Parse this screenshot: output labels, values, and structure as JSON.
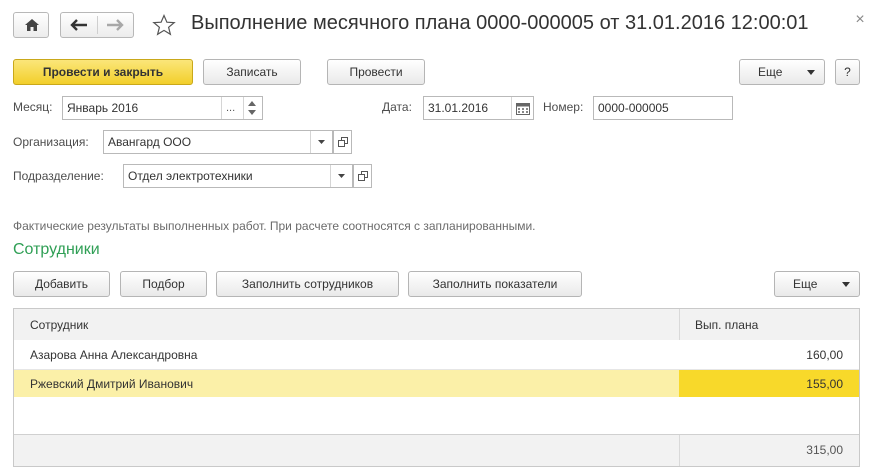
{
  "window": {
    "title": "Выполнение месячного плана 0000-000005 от 31.01.2016 12:00:01",
    "close_glyph": "×"
  },
  "toolbar": {
    "post_close_label": "Провести и закрыть",
    "save_label": "Записать",
    "post_label": "Провести",
    "more_label": "Еще",
    "help_label": "?"
  },
  "form": {
    "month_label": "Месяц:",
    "month_value": "Январь 2016",
    "month_ellipsis": "...",
    "date_label": "Дата:",
    "date_value": "31.01.2016",
    "number_label": "Номер:",
    "number_value": "0000-000005",
    "org_label": "Организация:",
    "org_value": "Авангард ООО",
    "dept_label": "Подразделение:",
    "dept_value": "Отдел электротехники"
  },
  "hint_text": "Фактические результаты выполненных работ. При расчете соотносятся с запланированными.",
  "employees": {
    "section_title": "Сотрудники",
    "add_label": "Добавить",
    "pick_label": "Подбор",
    "fill_employees_label": "Заполнить сотрудников",
    "fill_indicators_label": "Заполнить показатели",
    "more_label": "Еще",
    "columns": [
      "Сотрудник",
      "Вып. плана"
    ],
    "rows": [
      {
        "name": "Азарова Анна Александровна",
        "value": "160,00"
      },
      {
        "name": "Ржевский Дмитрий Иванович",
        "value": "155,00"
      }
    ],
    "total": "315,00"
  },
  "colors": {
    "accent_yellow": "#f2cf2b",
    "selected_row": "#fbf0a8",
    "selected_cell": "#f8d92a",
    "section_green": "#2f9f55"
  }
}
